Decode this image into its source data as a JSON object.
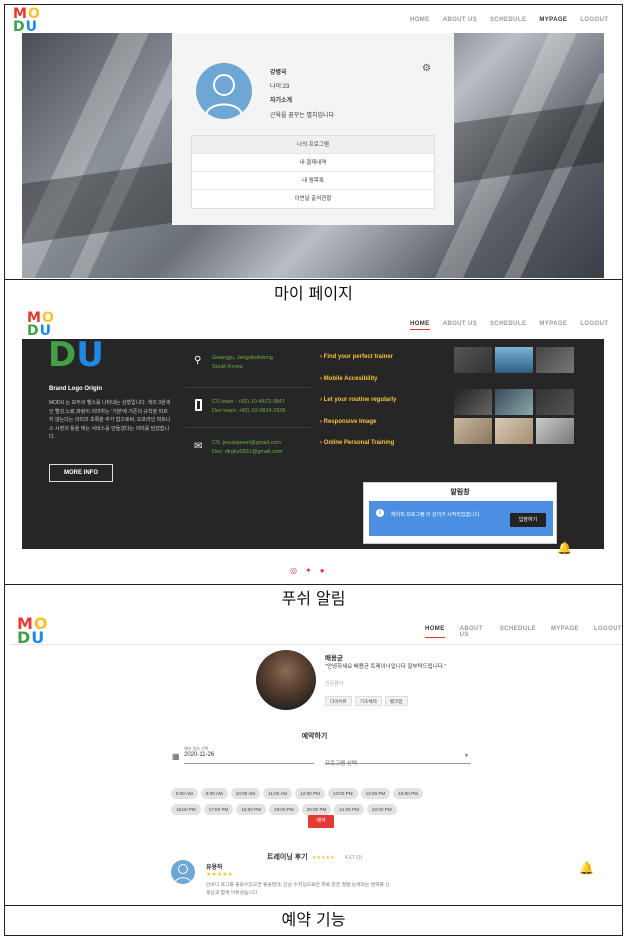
{
  "captions": [
    "마이 페이지",
    "푸쉬 알림",
    "예약 기능"
  ],
  "logo": {
    "m": "M",
    "o": "O",
    "d": "D",
    "u": "U"
  },
  "nav1": [
    "HOME",
    "ABOUT US",
    "SCHEDULE",
    "MYPAGE",
    "LOGOUT"
  ],
  "nav1_active": "MYPAGE",
  "nav2": [
    "HOME",
    "ABOUT US",
    "SCHEDULE",
    "MYPAGE",
    "LOGOUT"
  ],
  "nav3": [
    "HOME",
    "ABOUT US",
    "SCHEDULE",
    "MYPAGE",
    "LOGOUT"
  ],
  "mypage": {
    "name": "강병국",
    "age": "나이:23",
    "intro_title": "자기소개",
    "intro_text": "근육을 꿈꾸는 멸치입니다",
    "menu": [
      "나의 프로그램",
      "내 결제내역",
      "내 찜목록",
      "이번달 출석현황"
    ]
  },
  "footer": {
    "brand_title": "Brand Logo Origin",
    "brand_text": "MODU 는 모두의 헬스를 나타내는 상형입니다. 색의 3원색인 빨강,노랑,파랑이 의미하는 '기본'에 기존의 규칙을 따르지 않는다는 의미의 초록을 추가 함으로써, 오프라인 피트니스 시장의 틀을 깨는 서비스를 만들겠다는 의미를 담았습니다.",
    "more_info": "MORE INFO",
    "address": [
      "Gwangju, Jangdeokdong",
      "South Korea"
    ],
    "phones": [
      "CS team : +82) 10-4873-3847",
      "Dev team: +82) 10-0824-2938"
    ],
    "emails": [
      "CS: jesuisjavert@gmail.com",
      "Dev: dlrgks0831@gmail.com"
    ],
    "features": [
      "› Find your perfect trainer",
      "› Mobile Accesibility",
      "› Let your routine regularly",
      "› Responsive Image",
      "› Online Personal Training"
    ]
  },
  "notification": {
    "title": "알림창",
    "message": "헤이직 프로그램 이 강의가 시작되었습니다.",
    "button": "입장하기"
  },
  "trainer": {
    "name": "배용균",
    "quote": "\"안녕하세요 배용균 트레이너입니다 잘부탁드립니다.\"",
    "field_label": "전문분야",
    "tags": [
      "다이어트",
      "기초체력",
      "벌크업"
    ]
  },
  "reservation": {
    "title": "예약하기",
    "date_label": "예약 일자 선택",
    "date_value": "2020-11-26",
    "program_placeholder": "프로그램 선택",
    "times_row1": [
      "8:00 AM",
      "9:00 AM",
      "10:00 AM",
      "11:00 AM",
      "12:00 PM",
      "13:00 PM",
      "14:00 PM",
      "15:00 PM"
    ],
    "times_row2": [
      "16:00 PM",
      "17:00 PM",
      "18:00 PM",
      "19:00 PM",
      "20:00 PM",
      "21:00 PM",
      "22:00 PM"
    ],
    "submit": "예약"
  },
  "review": {
    "title": "트레이닝 후기",
    "stars": "★★★★★",
    "rating": "4.67 (3)",
    "reviewer": "유용하",
    "reviewer_stars": "★★★★★",
    "text_line1": "인바디 로그를 올릴수있으면 좋을텐데, 단순 수치상으로만 뭐봐 같은 형발 눈에띄는 변화를 선",
    "text_line2": "생님과 함께 이뤄냈습니다."
  },
  "colors": {
    "accent": "#e53935",
    "green": "#6ab04c",
    "yellow": "#f5c33b",
    "blue": "#4b8fe2"
  }
}
